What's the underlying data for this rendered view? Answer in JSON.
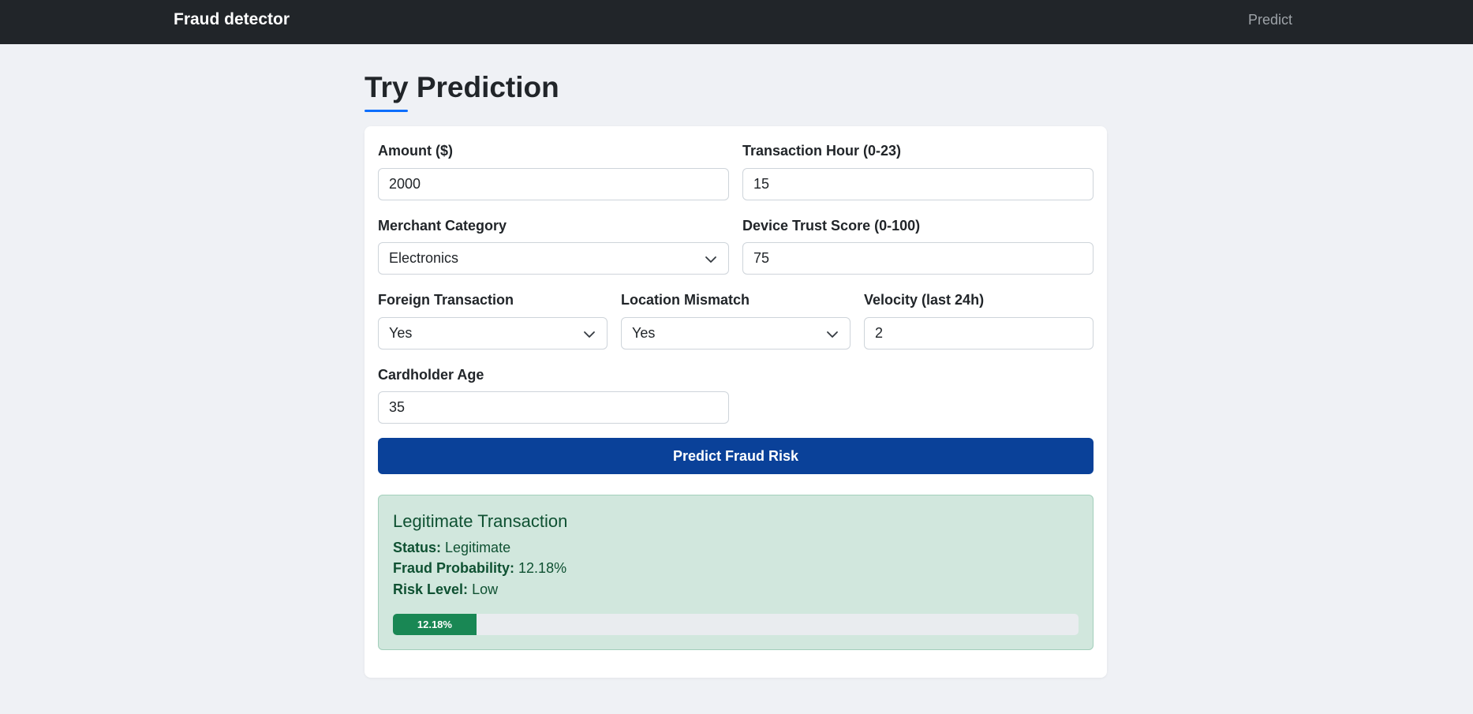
{
  "navbar": {
    "brand": "Fraud detector",
    "link": "Predict"
  },
  "page": {
    "title": "Try Prediction"
  },
  "form": {
    "amount": {
      "label": "Amount ($)",
      "value": "2000"
    },
    "transaction_hour": {
      "label": "Transaction Hour (0-23)",
      "value": "15"
    },
    "merchant_category": {
      "label": "Merchant Category",
      "value": "Electronics"
    },
    "device_trust_score": {
      "label": "Device Trust Score (0-100)",
      "value": "75"
    },
    "foreign_transaction": {
      "label": "Foreign Transaction",
      "value": "Yes"
    },
    "location_mismatch": {
      "label": "Location Mismatch",
      "value": "Yes"
    },
    "velocity": {
      "label": "Velocity (last 24h)",
      "value": "2"
    },
    "cardholder_age": {
      "label": "Cardholder Age",
      "value": "35"
    },
    "submit_label": "Predict Fraud Risk"
  },
  "result": {
    "heading": "Legitimate Transaction",
    "status_label": "Status:",
    "status_value": "Legitimate",
    "probability_label": "Fraud Probability:",
    "probability_value": "12.18%",
    "risk_label": "Risk Level:",
    "risk_value": "Low",
    "progress_text": "12.18%",
    "progress_fraction": 0.1218
  },
  "colors": {
    "navbar_bg": "#212529",
    "primary_button": "#0a4199",
    "accent_underline": "#0d6efd",
    "success_bg": "#d1e7dd",
    "success_text": "#0f5132",
    "progress_fill": "#198754"
  },
  "icons": {
    "select_indicator": "chevron-down-icon"
  }
}
